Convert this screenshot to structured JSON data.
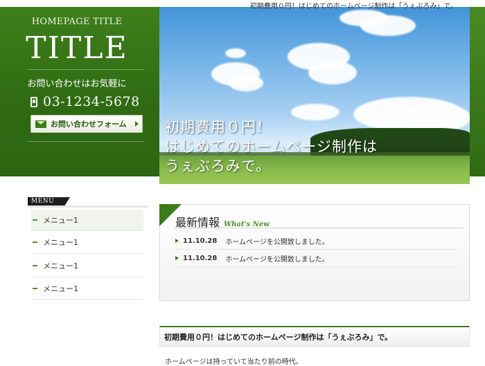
{
  "header": {
    "tagline": "初期費用０円！はじめてのホームページ制作は「うぇぶろみ」で。",
    "home_title": "HOMEPAGE TITLE",
    "title": "TITLE",
    "contact_label": "お問い合わせはお気軽に",
    "phone": "03-1234-5678",
    "contact_button": "お問い合わせフォーム"
  },
  "hero": {
    "line1": "初期費用０円！",
    "line2": "はじめてのホームページ制作は",
    "line3": "うぇぶろみで。"
  },
  "menu": {
    "label": "MENU",
    "items": [
      {
        "label": "メニュー1",
        "active": true
      },
      {
        "label": "メニュー1",
        "active": false
      },
      {
        "label": "メニュー1",
        "active": false
      },
      {
        "label": "メニュー1",
        "active": false
      }
    ]
  },
  "news": {
    "title": "最新情報",
    "subtitle": "What's New",
    "items": [
      {
        "date": "11.10.28",
        "text": "ホームページを公開致しました。"
      },
      {
        "date": "11.10.28",
        "text": "ホームページを公開致しました。"
      }
    ]
  },
  "section": {
    "heading": "初期費用０円！はじめてのホームページ制作は「うぇぶろみ」で。",
    "text": "ホームページは持っていて当たり前の時代。"
  },
  "colors": {
    "brand_green": "#3b7b18",
    "accent": "#4f8b28"
  }
}
